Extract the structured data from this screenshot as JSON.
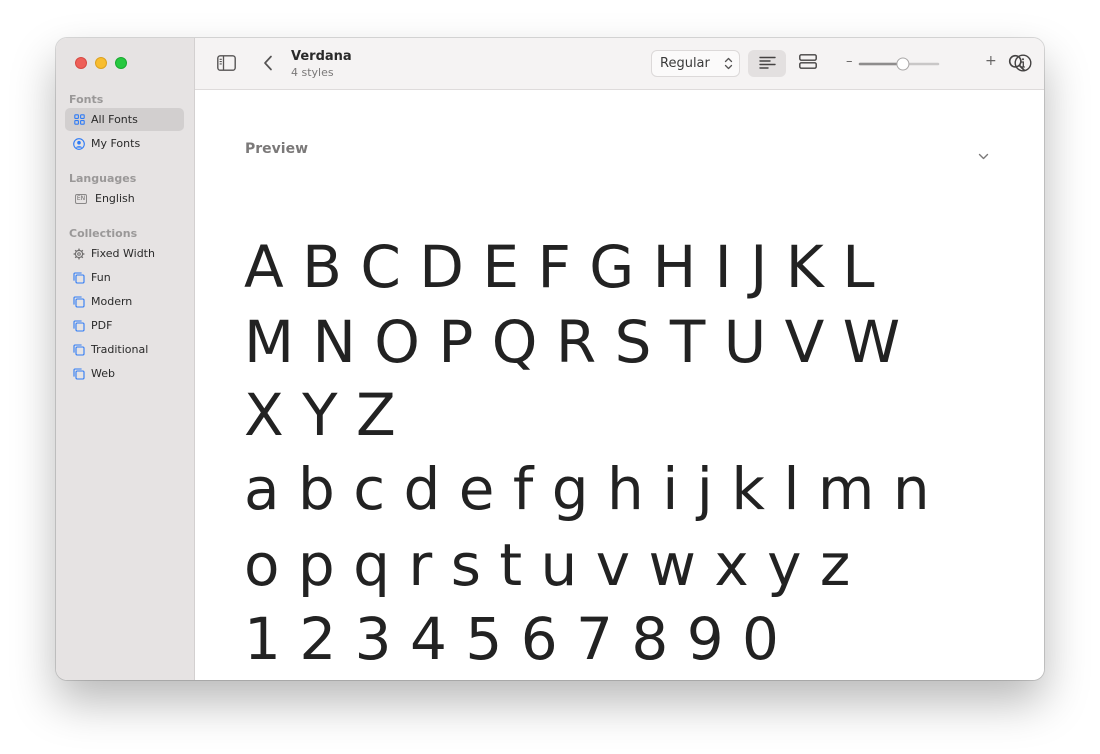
{
  "window": {
    "traffic_lights": [
      "close",
      "minimize",
      "zoom"
    ]
  },
  "sidebar": {
    "sections": [
      {
        "heading": "Fonts",
        "items": [
          {
            "label": "All Fonts",
            "icon": "grid-icon",
            "selected": true
          },
          {
            "label": "My Fonts",
            "icon": "person-circle-icon",
            "selected": false
          }
        ]
      },
      {
        "heading": "Languages",
        "items": [
          {
            "label": "English",
            "icon": "language-badge-icon",
            "badge": "EN",
            "selected": false
          }
        ]
      },
      {
        "heading": "Collections",
        "items": [
          {
            "label": "Fixed Width",
            "icon": "gear-icon",
            "selected": false
          },
          {
            "label": "Fun",
            "icon": "collection-icon",
            "selected": false
          },
          {
            "label": "Modern",
            "icon": "collection-icon",
            "selected": false
          },
          {
            "label": "PDF",
            "icon": "collection-icon",
            "selected": false
          },
          {
            "label": "Traditional",
            "icon": "collection-icon",
            "selected": false
          },
          {
            "label": "Web",
            "icon": "collection-icon",
            "selected": false
          }
        ]
      }
    ]
  },
  "toolbar": {
    "font_name": "Verdana",
    "style_count": "4 styles",
    "style_select_value": "Regular",
    "zoom_minus": "–",
    "zoom_plus": "+",
    "zoom_level": 0.55,
    "icons": [
      "sidebar-toggle-icon",
      "back-chevron-icon",
      "align-left-icon",
      "grid-view-icon",
      "info-icon",
      "search-icon"
    ]
  },
  "content": {
    "section_title": "Preview",
    "sample_lines": [
      "A B C D E F G H I J K L",
      "M N O P Q R S T U V W",
      "X Y Z",
      "a b c d e f g h i j k l m n",
      "o p q r s t u v w x y z",
      "1 2 3 4 5 6 7 8 9 0"
    ]
  },
  "colors": {
    "sidebar_bg": "#e6e3e3",
    "selected_bg": "#d2cfcf",
    "accent_blue": "#2f7bf5",
    "text": "#222222"
  }
}
